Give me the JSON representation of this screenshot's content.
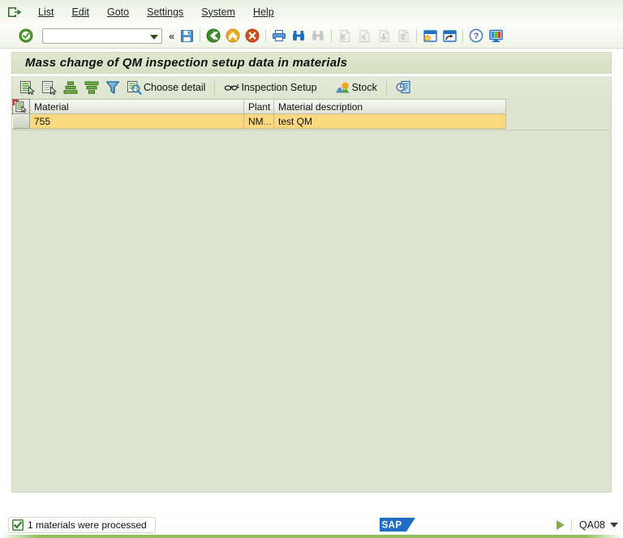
{
  "window": {
    "title": "Mass change of QM inspection setup data in materials"
  },
  "menubar": {
    "system_icon": "session-icon",
    "items": [
      {
        "label": "List",
        "accel": "L"
      },
      {
        "label": "Edit",
        "accel": "E"
      },
      {
        "label": "Goto",
        "accel": "G"
      },
      {
        "label": "Settings",
        "accel": "S"
      },
      {
        "label": "System",
        "accel": "y"
      },
      {
        "label": "Help",
        "accel": "H"
      }
    ]
  },
  "toolbar": {
    "enter_icon": "green-check-icon",
    "command_field": {
      "value": "",
      "placeholder": "",
      "dropdown_icon": "chevron-down-icon"
    },
    "collapse_icon": "double-chevron-left-icon",
    "buttons": [
      {
        "name": "save-button",
        "icon": "save-icon",
        "enabled": true
      },
      {
        "name": "back-button",
        "icon": "green-back-arrow-icon",
        "enabled": true
      },
      {
        "name": "exit-button",
        "icon": "yellow-up-arrow-icon",
        "enabled": true
      },
      {
        "name": "cancel-button",
        "icon": "red-cancel-icon",
        "enabled": true
      },
      {
        "name": "print-button",
        "icon": "printer-icon",
        "enabled": true
      },
      {
        "name": "find-button",
        "icon": "binoculars-icon",
        "enabled": true
      },
      {
        "name": "find-next-button",
        "icon": "binoculars-plus-icon",
        "enabled": false
      },
      {
        "name": "first-page-button",
        "icon": "first-page-icon",
        "enabled": false
      },
      {
        "name": "previous-page-button",
        "icon": "previous-page-icon",
        "enabled": false
      },
      {
        "name": "next-page-button",
        "icon": "next-page-icon",
        "enabled": false
      },
      {
        "name": "last-page-button",
        "icon": "last-page-icon",
        "enabled": false
      },
      {
        "name": "create-session-button",
        "icon": "new-session-icon",
        "enabled": true
      },
      {
        "name": "create-shortcut-button",
        "icon": "shortcut-icon",
        "enabled": true
      },
      {
        "name": "help-button",
        "icon": "question-help-icon",
        "enabled": true
      },
      {
        "name": "customize-layout-button",
        "icon": "monitor-layout-icon",
        "enabled": true
      }
    ]
  },
  "app_toolbar": {
    "buttons": [
      {
        "name": "select-all-button",
        "icon": "select-all-icon",
        "label": ""
      },
      {
        "name": "deselect-all-button",
        "icon": "deselect-all-icon",
        "label": ""
      },
      {
        "name": "sort-ascending-button",
        "icon": "sort-ascending-icon",
        "label": ""
      },
      {
        "name": "sort-descending-button",
        "icon": "sort-descending-icon",
        "label": ""
      },
      {
        "name": "filter-button",
        "icon": "filter-icon",
        "label": ""
      },
      {
        "name": "choose-detail-button",
        "icon": "choose-detail-icon",
        "label": "Choose detail"
      },
      {
        "name": "inspection-setup-button",
        "icon": "inspection-setup-icon",
        "label": "Inspection Setup"
      },
      {
        "name": "stock-button",
        "icon": "stock-mountain-icon",
        "label": "Stock"
      },
      {
        "name": "history-button",
        "icon": "clock-document-icon",
        "label": ""
      }
    ]
  },
  "grid": {
    "select_all_icon": "grid-select-all-icon",
    "columns": [
      {
        "key": "material",
        "label": "Material"
      },
      {
        "key": "plant",
        "label": "Plant"
      },
      {
        "key": "description",
        "label": "Material description"
      }
    ],
    "rows": [
      {
        "material": "755",
        "plant": "NM",
        "plant_truncated": "...",
        "description": "test QM",
        "selected": true
      }
    ]
  },
  "statusbar": {
    "message_icon": "green-check-status-icon",
    "message": "1 materials were processed",
    "logo": "SAP",
    "expand_icon": "triangle-right-icon",
    "system": "QA08",
    "system_dropdown_icon": "chevron-down-icon"
  },
  "colors": {
    "window_bg": "#ffffff",
    "menu_bg": "#eef3e6",
    "title_bg": "#d9e2c8",
    "content_bg": "#dce4d0",
    "row_selected": "#fbd981",
    "header_cell": "#eceee6",
    "accent_green": "#8fbf5e",
    "sap_blue": "#1f6fc4"
  }
}
